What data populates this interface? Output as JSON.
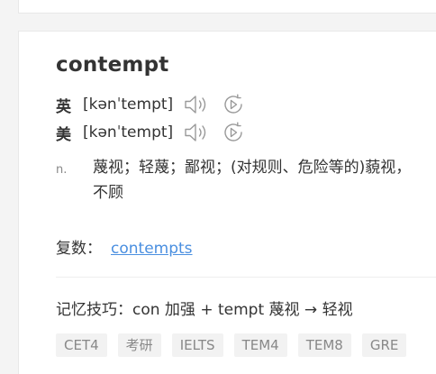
{
  "entry": {
    "word": "contempt",
    "pronunciations": [
      {
        "tag": "英",
        "phonetic": "[kənˈtempt]",
        "speaker_icon": "speaker-icon",
        "replay_icon": "replay-icon"
      },
      {
        "tag": "美",
        "phonetic": "[kənˈtempt]",
        "speaker_icon": "speaker-icon",
        "replay_icon": "replay-icon"
      }
    ],
    "definition": {
      "pos": "n.",
      "text": "蔑视；轻蔑；鄙视；(对规则、危险等的)藐视，不顾"
    },
    "plural": {
      "label": "复数：",
      "value": "contempts"
    },
    "memory_tip": "记忆技巧：con 加强 + tempt 蔑视 → 轻视",
    "tags": [
      "CET4",
      "考研",
      "IELTS",
      "TEM4",
      "TEM8",
      "GRE"
    ]
  },
  "colors": {
    "link": "#4a8fe0",
    "tag_bg": "#f2f2f2",
    "tag_text": "#888888",
    "icon": "#999999"
  }
}
